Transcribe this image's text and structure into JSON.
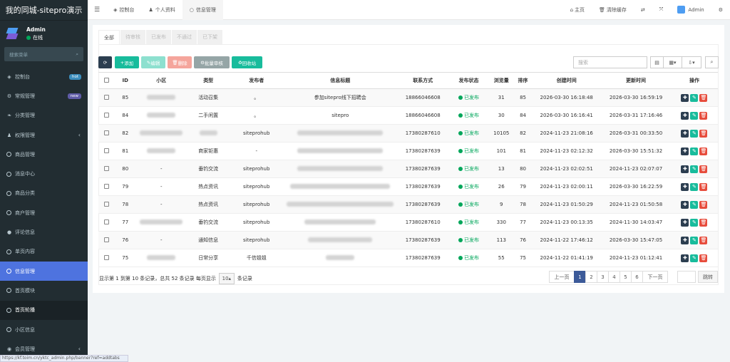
{
  "app": {
    "title": "我的同城-sitepro演示",
    "user": "Admin",
    "user_status": "在线",
    "search_placeholder": "搜索菜单"
  },
  "menu": [
    {
      "icon": "dashboard-icon",
      "label": "控制台",
      "badge": "hot",
      "badge_color": "#3c8dbc"
    },
    {
      "icon": "gear-icon",
      "label": "常规管理",
      "badge": "new",
      "badge_color": "#605ca8"
    },
    {
      "icon": "leaf-icon",
      "label": "分类管理"
    },
    {
      "icon": "users-icon",
      "label": "权限管理",
      "arrow": "‹"
    },
    {
      "icon": "circle-icon",
      "label": "商品管理"
    },
    {
      "icon": "circle-icon",
      "label": "消息中心"
    },
    {
      "icon": "circle-icon",
      "label": "商品分类"
    },
    {
      "icon": "circle-icon",
      "label": "商户管理"
    },
    {
      "icon": "comment-icon",
      "label": "评论信息"
    },
    {
      "icon": "circle-icon",
      "label": "单页内容"
    },
    {
      "icon": "circle-icon",
      "label": "信息管理",
      "active": true
    },
    {
      "icon": "circle-icon",
      "label": "首页模块"
    },
    {
      "icon": "circle-icon",
      "label": "首页轮播",
      "dark": true
    },
    {
      "icon": "circle-icon",
      "label": "小区信息"
    },
    {
      "icon": "user-circle-icon",
      "label": "会员管理",
      "arrow": "‹"
    }
  ],
  "topbar": {
    "menu_icon": "☰",
    "tabs": [
      {
        "icon": "dashboard-icon",
        "label": "控制台"
      },
      {
        "icon": "user-icon",
        "label": "个人资料"
      },
      {
        "icon": "circle-icon",
        "label": "信息管理"
      }
    ],
    "home": "主页",
    "clear_cache": "清除缓存",
    "admin": "Admin"
  },
  "filter_tabs": [
    "全部",
    "待审核",
    "已发布",
    "不通过",
    "已下架"
  ],
  "toolbar": {
    "add": "添加",
    "edit": "编辑",
    "delete": "删除",
    "batch_review": "批量审核",
    "recycle": "回收站",
    "search_placeholder": "搜索"
  },
  "table": {
    "headers": [
      "ID",
      "小区",
      "类型",
      "发布者",
      "信息标题",
      "联系方式",
      "发布状态",
      "浏览量",
      "排序",
      "创建时间",
      "更新时间",
      "操作"
    ],
    "rows": [
      {
        "id": "85",
        "area": "",
        "type": "活动召集",
        "publisher": "。",
        "title": "参加sitepro线下招聘会",
        "contact": "18866046608",
        "status": "已发布",
        "views": "31",
        "sort": "85",
        "created": "2026-03-30 16:18:48",
        "updated": "2026-03-30 16:59:19"
      },
      {
        "id": "84",
        "area": "",
        "type": "二手闲置",
        "publisher": "。",
        "title": "sitepro",
        "contact": "18866046608",
        "status": "已发布",
        "views": "30",
        "sort": "84",
        "created": "2026-03-30 16:16:41",
        "updated": "2026-03-31 17:16:46"
      },
      {
        "id": "82",
        "area": "",
        "type": "",
        "publisher": "siteprohub",
        "title": "",
        "contact": "17380287610",
        "status": "已发布",
        "views": "10105",
        "sort": "82",
        "created": "2024-11-23 21:08:16",
        "updated": "2026-03-31 00:33:50"
      },
      {
        "id": "81",
        "area": "",
        "type": "商家钜惠",
        "publisher": "-",
        "title": "",
        "contact": "17380287639",
        "status": "已发布",
        "views": "101",
        "sort": "81",
        "created": "2024-11-23 02:12:32",
        "updated": "2026-03-30 15:51:32"
      },
      {
        "id": "80",
        "area": "-",
        "type": "垂钓交流",
        "publisher": "siteprohub",
        "title": "",
        "contact": "17380287639",
        "status": "已发布",
        "views": "13",
        "sort": "80",
        "created": "2024-11-23 02:02:51",
        "updated": "2024-11-23 02:07:07"
      },
      {
        "id": "79",
        "area": "-",
        "type": "热点资讯",
        "publisher": "siteprohub",
        "title": "",
        "contact": "17380287639",
        "status": "已发布",
        "views": "26",
        "sort": "79",
        "created": "2024-11-23 02:00:11",
        "updated": "2026-03-30 16:22:59"
      },
      {
        "id": "78",
        "area": "-",
        "type": "热点资讯",
        "publisher": "siteprohub",
        "title": "",
        "contact": "17380287639",
        "status": "已发布",
        "views": "9",
        "sort": "78",
        "created": "2024-11-23 01:50:29",
        "updated": "2024-11-23 01:50:58"
      },
      {
        "id": "77",
        "area": "",
        "type": "垂钓交流",
        "publisher": "siteprohub",
        "title": "",
        "contact": "17380287610",
        "status": "已发布",
        "views": "330",
        "sort": "77",
        "created": "2024-11-23 00:13:35",
        "updated": "2024-11-30 14:03:47"
      },
      {
        "id": "76",
        "area": "-",
        "type": "通知信息",
        "publisher": "siteprohub",
        "title": "",
        "contact": "17380287639",
        "status": "已发布",
        "views": "113",
        "sort": "76",
        "created": "2024-11-22 17:46:12",
        "updated": "2026-03-30 15:47:05"
      },
      {
        "id": "75",
        "area": "",
        "type": "日常分享",
        "publisher": "千信姐姐",
        "title": "",
        "contact": "17380287639",
        "status": "已发布",
        "views": "55",
        "sort": "75",
        "created": "2024-11-22 01:41:19",
        "updated": "2024-11-23 01:12:41"
      }
    ]
  },
  "footer": {
    "summary_pre": "显示第 1 到第 10 条记录，总共 52 条记录 每页显示",
    "page_size": "10",
    "summary_post": "条记录",
    "prev": "上一页",
    "next": "下一页",
    "pages": [
      "1",
      "2",
      "3",
      "4",
      "5",
      "6"
    ],
    "jump": "跳转"
  },
  "status_url": "https://kf.toim.cn/yktc_admin.php/banner?ref=addtabs"
}
